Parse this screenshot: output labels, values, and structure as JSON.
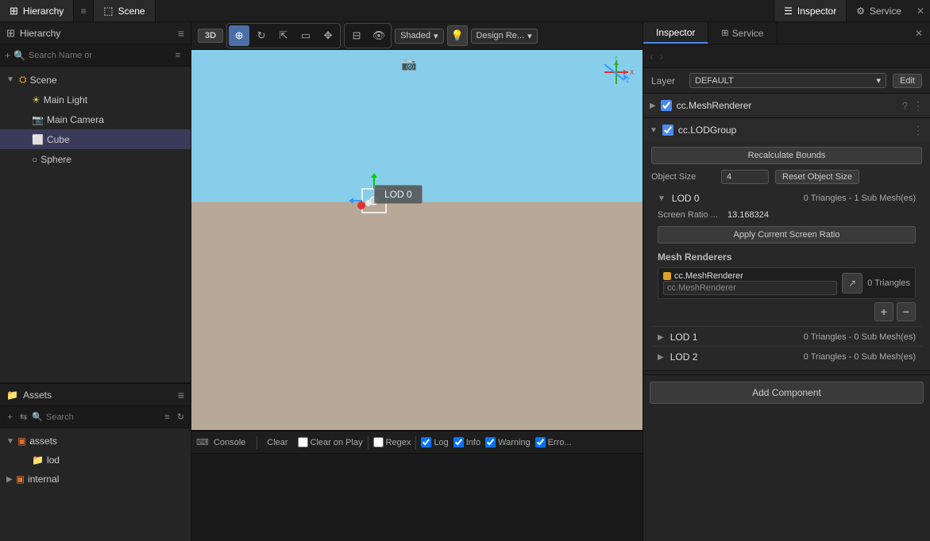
{
  "topBar": {
    "hierarchyTab": "Hierarchy",
    "sceneTab": "Scene",
    "inspectorTab": "Inspector",
    "serviceTab": "Service"
  },
  "hierarchy": {
    "searchPlaceholder": "Search Name or",
    "scene": "Scene",
    "items": [
      {
        "id": "main-light",
        "label": "Main Light",
        "level": 1
      },
      {
        "id": "main-camera",
        "label": "Main Camera",
        "level": 1
      },
      {
        "id": "cube",
        "label": "Cube",
        "level": 1,
        "selected": true
      },
      {
        "id": "sphere",
        "label": "Sphere",
        "level": 1
      }
    ]
  },
  "assets": {
    "searchPlaceholder": "Search",
    "items": [
      {
        "id": "assets-root",
        "label": "assets",
        "level": 0,
        "expanded": true
      },
      {
        "id": "lod",
        "label": "lod",
        "level": 1
      },
      {
        "id": "internal",
        "label": "internal",
        "level": 0,
        "expanded": false
      }
    ]
  },
  "sceneToolbar": {
    "btn3d": "3D",
    "shadeMode": "Shaded",
    "designMode": "Design Re...",
    "tools": [
      "move",
      "rotate",
      "scale",
      "rect",
      "transform",
      "anchor",
      "visible",
      "light"
    ]
  },
  "scene": {
    "lodLabel": "LOD 0"
  },
  "console": {
    "clearBtn": "Clear",
    "clearOnPlayBtn": "Clear on Play",
    "regexBtn": "Regex",
    "logCheck": "Log",
    "infoCheck": "Info",
    "warningCheck": "Warning",
    "errorCheck": "Erro..."
  },
  "inspector": {
    "title": "Inspector",
    "serviceTitle": "Service",
    "layer": {
      "label": "Layer",
      "value": "DEFAULT",
      "editBtn": "Edit"
    },
    "meshRenderer": {
      "title": "cc.MeshRenderer",
      "enabled": true,
      "expanded": false
    },
    "lodGroup": {
      "title": "cc.LODGroup",
      "enabled": true,
      "expanded": true,
      "recalcBtn": "Recalculate Bounds",
      "objectSizeLabel": "Object Size",
      "objectSizeValue": "4",
      "resetObjectSizeBtn": "Reset Object Size",
      "lods": [
        {
          "id": "lod0",
          "label": "LOD 0",
          "stats": "0 Triangles - 1 Sub Mesh(es)",
          "screenRatioLabel": "Screen Ratio ...",
          "screenRatioValue": "13.168324",
          "applyBtn": "Apply Current Screen Ratio",
          "meshRenderers": {
            "title": "Mesh Renderers",
            "items": [
              {
                "componentName": "cc.MeshRenderer",
                "inputValue": "cc.MeshRenderer",
                "triangles": "0 Triangles"
              }
            ]
          }
        },
        {
          "id": "lod1",
          "label": "LOD 1",
          "stats": "0 Triangles - 0 Sub Mesh(es)"
        },
        {
          "id": "lod2",
          "label": "LOD 2",
          "stats": "0 Triangles - 0 Sub Mesh(es)"
        }
      ]
    },
    "addComponentBtn": "Add Component"
  }
}
